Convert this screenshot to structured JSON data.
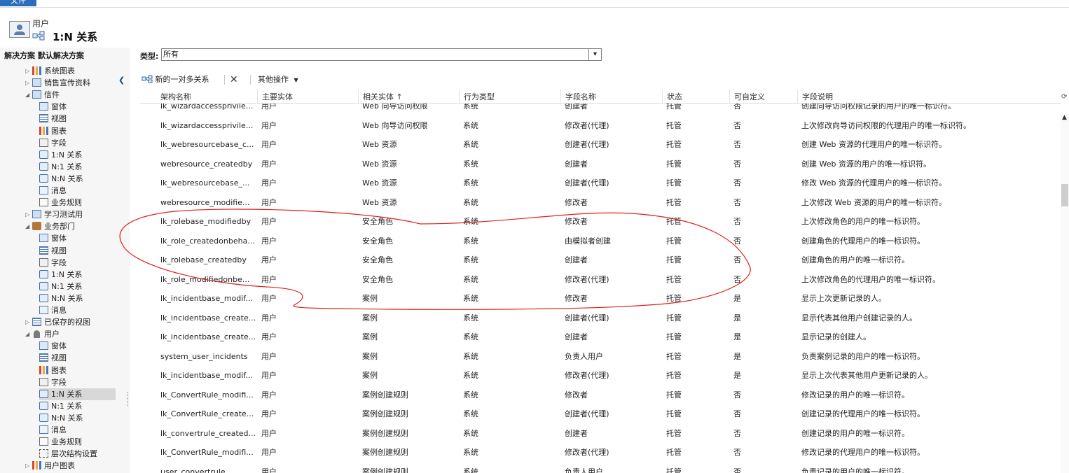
{
  "app": {
    "file_tab": "文件"
  },
  "header": {
    "entity": "用户",
    "title": "1:N 关系"
  },
  "sidebar": {
    "heading": "解决方案 默认解决方案",
    "items": [
      {
        "label": "系统图表",
        "icon": "chart-icon",
        "indent": 1,
        "expand": "▷"
      },
      {
        "label": "销售宣传资料",
        "icon": "entity-icon",
        "indent": 1,
        "expand": "▷"
      },
      {
        "label": "信件",
        "icon": "entity-icon",
        "indent": 1,
        "expand": "◢"
      },
      {
        "label": "窗体",
        "icon": "form-icon",
        "indent": 2,
        "expand": ""
      },
      {
        "label": "视图",
        "icon": "view-icon",
        "indent": 2,
        "expand": ""
      },
      {
        "label": "图表",
        "icon": "chart-icon",
        "indent": 2,
        "expand": ""
      },
      {
        "label": "字段",
        "icon": "field-icon",
        "indent": 2,
        "expand": ""
      },
      {
        "label": "1:N 关系",
        "icon": "relationship-icon",
        "indent": 2,
        "expand": ""
      },
      {
        "label": "N:1 关系",
        "icon": "relationship-icon",
        "indent": 2,
        "expand": ""
      },
      {
        "label": "N:N 关系",
        "icon": "relationship-icon",
        "indent": 2,
        "expand": ""
      },
      {
        "label": "消息",
        "icon": "message-icon",
        "indent": 2,
        "expand": ""
      },
      {
        "label": "业务规则",
        "icon": "business-rule-icon",
        "indent": 2,
        "expand": ""
      },
      {
        "label": "学习测试用",
        "icon": "entity-icon",
        "indent": 1,
        "expand": "▷"
      },
      {
        "label": "业务部门",
        "icon": "folder-icon",
        "indent": 1,
        "expand": "◢"
      },
      {
        "label": "窗体",
        "icon": "form-icon",
        "indent": 2,
        "expand": ""
      },
      {
        "label": "视图",
        "icon": "view-icon",
        "indent": 2,
        "expand": ""
      },
      {
        "label": "字段",
        "icon": "field-icon",
        "indent": 2,
        "expand": ""
      },
      {
        "label": "1:N 关系",
        "icon": "relationship-icon",
        "indent": 2,
        "expand": ""
      },
      {
        "label": "N:1 关系",
        "icon": "relationship-icon",
        "indent": 2,
        "expand": ""
      },
      {
        "label": "N:N 关系",
        "icon": "relationship-icon",
        "indent": 2,
        "expand": ""
      },
      {
        "label": "消息",
        "icon": "message-icon",
        "indent": 2,
        "expand": ""
      },
      {
        "label": "已保存的视图",
        "icon": "view-icon",
        "indent": 1,
        "expand": "▷"
      },
      {
        "label": "用户",
        "icon": "user-icon",
        "indent": 1,
        "expand": "◢"
      },
      {
        "label": "窗体",
        "icon": "form-icon",
        "indent": 2,
        "expand": ""
      },
      {
        "label": "视图",
        "icon": "view-icon",
        "indent": 2,
        "expand": ""
      },
      {
        "label": "图表",
        "icon": "chart-icon",
        "indent": 2,
        "expand": ""
      },
      {
        "label": "字段",
        "icon": "field-icon",
        "indent": 2,
        "expand": ""
      },
      {
        "label": "1:N 关系",
        "icon": "relationship-icon",
        "indent": 2,
        "expand": "",
        "selected": true
      },
      {
        "label": "N:1 关系",
        "icon": "relationship-icon",
        "indent": 2,
        "expand": ""
      },
      {
        "label": "N:N 关系",
        "icon": "relationship-icon",
        "indent": 2,
        "expand": ""
      },
      {
        "label": "消息",
        "icon": "message-icon",
        "indent": 2,
        "expand": ""
      },
      {
        "label": "业务规则",
        "icon": "business-rule-icon",
        "indent": 2,
        "expand": ""
      },
      {
        "label": "层次结构设置",
        "icon": "hierarchy-icon",
        "indent": 2,
        "expand": ""
      },
      {
        "label": "用户图表",
        "icon": "chart-icon",
        "indent": 1,
        "expand": "▷"
      }
    ]
  },
  "filter": {
    "label": "类型:",
    "value": "所有"
  },
  "toolbar": {
    "new_label": "新的一对多关系",
    "delete_label": "✕",
    "more_label": "其他操作"
  },
  "grid": {
    "columns": [
      "架构名称",
      "主要实体",
      "相关实体 ↑",
      "行为类型",
      "字段名称",
      "状态",
      "可自定义",
      "字段说明"
    ],
    "rows": [
      [
        "lk_wizardaccessprivile...",
        "用户",
        "Web 向导访问权限",
        "系统",
        "创建者",
        "托管",
        "否",
        "创建向导访问权限记录的用户的唯一标识符。"
      ],
      [
        "lk_wizardaccessprivile...",
        "用户",
        "Web 向导访问权限",
        "系统",
        "修改者(代理)",
        "托管",
        "否",
        "上次修改向导访问权限的代理用户的唯一标识符。"
      ],
      [
        "lk_webresourcebase_c...",
        "用户",
        "Web 资源",
        "系统",
        "创建者(代理)",
        "托管",
        "否",
        "创建 Web 资源的代理用户的唯一标识符。"
      ],
      [
        "webresource_createdby",
        "用户",
        "Web 资源",
        "系统",
        "创建者",
        "托管",
        "否",
        "创建 Web 资源的用户的唯一标识符。"
      ],
      [
        "lk_webresourcebase_...",
        "用户",
        "Web 资源",
        "系统",
        "创建者(代理)",
        "托管",
        "否",
        "修改 Web 资源的代理用户的唯一标识符。"
      ],
      [
        "webresource_modifie...",
        "用户",
        "Web 资源",
        "系统",
        "修改者",
        "托管",
        "否",
        "上次修改 Web 资源的用户的唯一标识符。"
      ],
      [
        "lk_rolebase_modifiedby",
        "用户",
        "安全角色",
        "系统",
        "修改者",
        "托管",
        "否",
        "上次修改角色的用户的唯一标识符。"
      ],
      [
        "lk_role_createdonbeha...",
        "用户",
        "安全角色",
        "系统",
        "由模拟者创建",
        "托管",
        "否",
        "创建角色的代理用户的唯一标识符。"
      ],
      [
        "lk_rolebase_createdby",
        "用户",
        "安全角色",
        "系统",
        "创建者",
        "托管",
        "否",
        "创建角色的用户的唯一标识符。"
      ],
      [
        "lk_role_modifiedonbe...",
        "用户",
        "安全角色",
        "系统",
        "修改者(代理)",
        "托管",
        "否",
        "上次修改角色的代理用户的唯一标识符。"
      ],
      [
        "lk_incidentbase_modif...",
        "用户",
        "案例",
        "系统",
        "修改者",
        "托管",
        "是",
        "显示上次更新记录的人。"
      ],
      [
        "lk_incidentbase_create...",
        "用户",
        "案例",
        "系统",
        "创建者(代理)",
        "托管",
        "是",
        "显示代表其他用户创建记录的人。"
      ],
      [
        "lk_incidentbase_create...",
        "用户",
        "案例",
        "系统",
        "创建者",
        "托管",
        "是",
        "显示记录的创建人。"
      ],
      [
        "system_user_incidents",
        "用户",
        "案例",
        "系统",
        "负责人用户",
        "托管",
        "是",
        "负责案例记录的用户的唯一标识符。"
      ],
      [
        "lk_incidentbase_modif...",
        "用户",
        "案例",
        "系统",
        "修改者(代理)",
        "托管",
        "是",
        "显示上次代表其他用户更新记录的人。"
      ],
      [
        "lk_ConvertRule_modifi...",
        "用户",
        "案例创建规则",
        "系统",
        "修改者",
        "托管",
        "否",
        "修改记录的用户的唯一标识符。"
      ],
      [
        "lk_ConvertRule_create...",
        "用户",
        "案例创建规则",
        "系统",
        "创建者(代理)",
        "托管",
        "否",
        "创建记录的代理用户的唯一标识符。"
      ],
      [
        "lk_convertrule_created...",
        "用户",
        "案例创建规则",
        "系统",
        "创建者",
        "托管",
        "否",
        "创建记录的用户的唯一标识符。"
      ],
      [
        "lk_ConvertRule_modifi...",
        "用户",
        "案例创建规则",
        "系统",
        "修改者(代理)",
        "托管",
        "否",
        "修改记录的代理用户的唯一标识符。"
      ],
      [
        "user_convertrule",
        "用户",
        "案例创建规则",
        "系统",
        "负责人用户",
        "托管",
        "否",
        "负责记录的用户的唯一标识符。"
      ]
    ]
  },
  "annotation_color": "#e0201a"
}
